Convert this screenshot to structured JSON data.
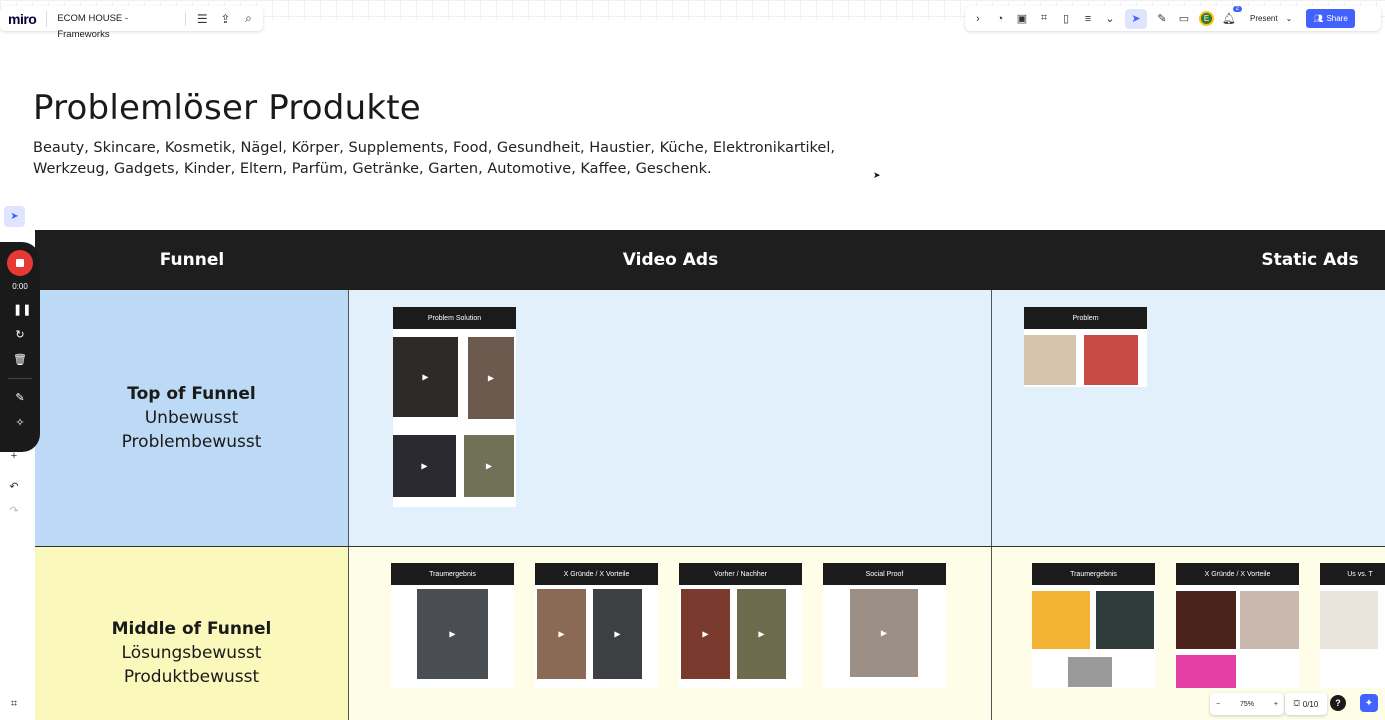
{
  "app": {
    "logo": "miro",
    "board_title": "ECOM HOUSE - Frameworks"
  },
  "toolbar_right": {
    "present_label": "Present",
    "share_label": "Share",
    "avatar_initial": "E",
    "notification_count": "2"
  },
  "board": {
    "title": "Problemlöser Produkte",
    "subtitle": "Beauty, Skincare, Kosmetik, Nägel, Körper, Supplements, Food, Gesundheit, Haustier, Küche, Elektronikartikel, Werkzeug, Gadgets, Kinder, Eltern, Parfüm, Getränke, Garten, Automotive, Kaffee, Geschenk."
  },
  "table": {
    "headers": [
      "Funnel",
      "Video Ads",
      "Static Ads"
    ],
    "rows": [
      {
        "funnel_title": "Top of Funnel",
        "funnel_lines": [
          "Unbewusst",
          "Problembewusst"
        ],
        "video_frames": [
          "Problem Solution"
        ],
        "static_frames": [
          "Problem"
        ]
      },
      {
        "funnel_title": "Middle of Funnel",
        "funnel_lines": [
          "Lösungsbewusst",
          "Produktbewusst"
        ],
        "video_frames": [
          "Traumergebnis",
          "X Gründe / X Vorteile",
          "Vorher / Nachher",
          "Social Proof"
        ],
        "static_frames": [
          "Traumergebnis",
          "X Gründe / X Vorteile",
          "Us vs. T"
        ]
      }
    ]
  },
  "recorder": {
    "time": "0:00"
  },
  "zoom": {
    "level": "75%"
  },
  "frames_counter": "0/10",
  "colors": {
    "accent": "#4262ff",
    "header_bg": "#1e1e1e",
    "top_funnel_bg": "#bcdaf5",
    "middle_funnel_bg": "#fbf8bc",
    "record": "#e53935"
  }
}
